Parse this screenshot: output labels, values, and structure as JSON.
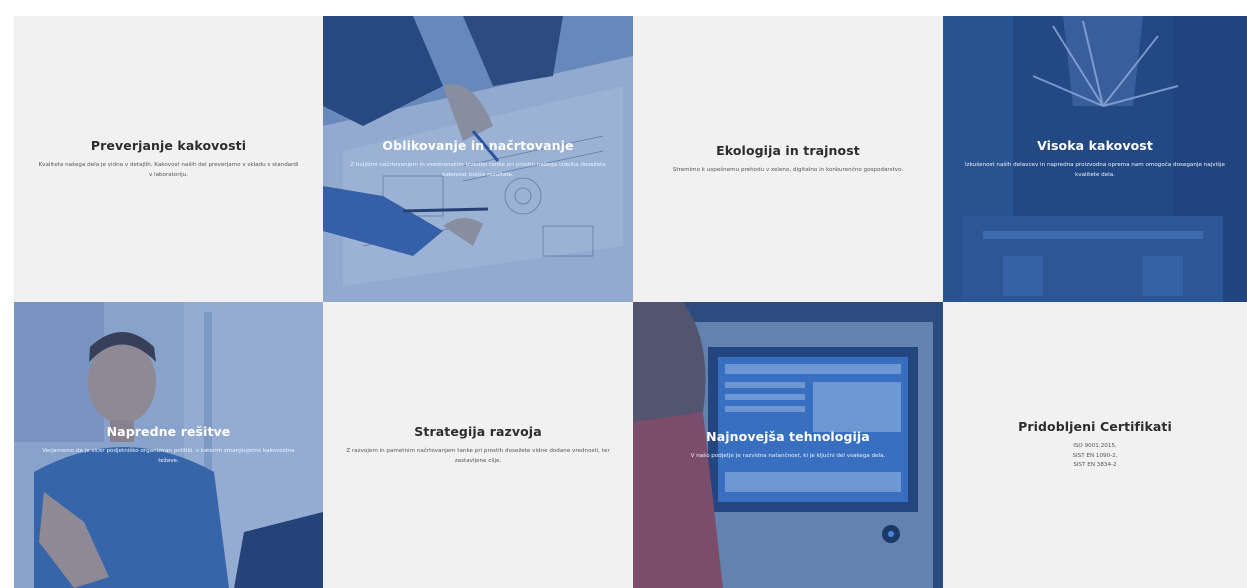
{
  "colors": {
    "plain_tile_bg": "#f1f1f1",
    "photo_overlay": "#2f5faa",
    "heading_dark": "#2d2d2d",
    "heading_light": "#ffffff"
  },
  "tiles": [
    {
      "title": "Preverjanje kakovosti",
      "text": "Kvaliteta našega dela je vidna v detajlih. Kakovost naših del preverjamo v skladu s standardi v laboratoriju.",
      "image": "quality-check"
    },
    {
      "title": "Oblikovanje in načrtovanje",
      "text": "Z boljšimi načrtovanjem in vsestranskim izvedbo tanke pri prostih našega izdelka dosežete kakovost boljše rezultate.",
      "image": "engineering-drawings-photo"
    },
    {
      "title": "Ekologija in trajnost",
      "text": "Stremimo k uspešnemu prehodu v zeleno, digitalno in konkurenčno gospodarstvo.",
      "image": "ecology"
    },
    {
      "title": "Visoka kakovost",
      "text": "Izkušenost naših delavcev in napredna proizvodna oprema nam omogoča doseganje najvišje kvalitete dela.",
      "image": "cnc-machining-photo"
    },
    {
      "title": "Napredne rešitve",
      "text": "Verjamemo da je sicer podjetniško organiziran politiki, s katerim zmanjšujemo kakovostne težave.",
      "image": "engineer-talking-photo"
    },
    {
      "title": "Strategija razvoja",
      "text": "Z razvojem in pametnim načrtovanjem tanke pri prostih dosežete vidne dodane vrednosti, ter zastavljene cilje.",
      "image": "strategy"
    },
    {
      "title": "Najnovejša tehnologija",
      "text": "V našo podjetje je razvidna natančnost, ki je ključni del vsakega dela.",
      "image": "machine-control-panel-photo"
    },
    {
      "title": "Pridobljeni Certifikati",
      "certificates": [
        "ISO 9001:2015,",
        "SIST EN 1090-2,",
        "SIST EN 3834-2"
      ],
      "image": "certificates"
    }
  ]
}
